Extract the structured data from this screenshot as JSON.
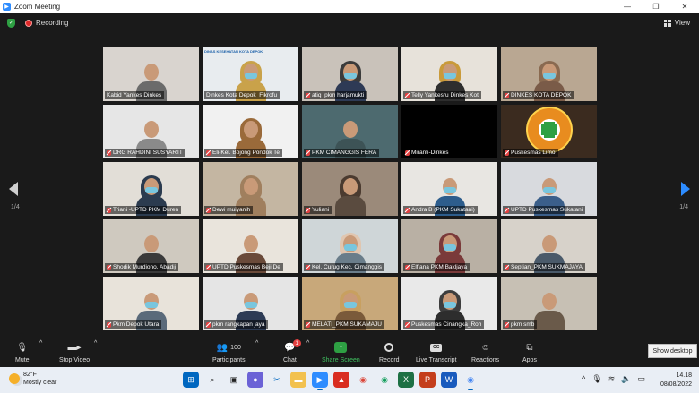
{
  "window": {
    "title": "Zoom Meeting",
    "app_icon": "zoom-icon"
  },
  "topbar": {
    "recording_label": "Recording",
    "view_label": "View"
  },
  "pagination": {
    "left": "1/4",
    "right": "1/4"
  },
  "colors": {
    "accent": "#2d8cff",
    "active_speaker": "#cfe23a",
    "recording": "#e02828",
    "share_green": "#2ea043"
  },
  "participants": [
    {
      "name": "Kabid Yankes Dinkes",
      "bg": "#d9d4cf",
      "shirt": "#6b6b6b",
      "hijab": "",
      "mask": false,
      "muted": false
    },
    {
      "name": "Dinkes Kota Depok_Fikrofu",
      "bg": "#e8ecef",
      "shirt": "#c9a24a",
      "hijab": "#c9a24a",
      "mask": true,
      "muted": false,
      "logo": "DINAS KESEHATAN KOTA DEPOK",
      "active": true
    },
    {
      "name": "atiq_pkm harjamukti",
      "bg": "#c9c2ba",
      "shirt": "#2e3a55",
      "hijab": "#3b3b3b",
      "mask": true,
      "muted": true
    },
    {
      "name": "Telly Yankesru Dinkes Kot",
      "bg": "#e7e2da",
      "shirt": "#2e2e2e",
      "hijab": "#c99a3a",
      "mask": true,
      "muted": true
    },
    {
      "name": "DINKES KOTA DEPOK",
      "bg": "#b9a792",
      "shirt": "#7a5b48",
      "hijab": "#8a6a50",
      "mask": true,
      "muted": true
    },
    {
      "name": "DRG RAHDINI SUSYARTI",
      "bg": "#e6e6e6",
      "shirt": "#8a8a8a",
      "hijab": "",
      "mask": false,
      "muted": true
    },
    {
      "name": "Eli-Kel. Bojong Pondok Te",
      "bg": "#f1f1f1",
      "shirt": "#9a6a3a",
      "hijab": "#9a6a3a",
      "mask": false,
      "muted": true
    },
    {
      "name": "PKM CIMANGGIS FERA",
      "bg": "#4d6a6f",
      "shirt": "#3d5356",
      "hijab": "",
      "mask": false,
      "muted": true
    },
    {
      "name": "Miranti-Dinkes",
      "bg": "#000000",
      "shirt": "#000000",
      "hijab": "",
      "mask": false,
      "muted": true,
      "black": true
    },
    {
      "name": "Puskesmas Limo",
      "bg": "#3b2b1f",
      "shirt": "#e88c1f",
      "hijab": "",
      "mask": false,
      "muted": true,
      "limo": true
    },
    {
      "name": "Triani -UPTD PKM Duren",
      "bg": "#e2ded7",
      "shirt": "#2b3b4f",
      "hijab": "#2b3b4f",
      "mask": true,
      "muted": true
    },
    {
      "name": "Dewi muiyanih",
      "bg": "#c4b6a2",
      "shirt": "#a07f5e",
      "hijab": "#a07f5e",
      "mask": false,
      "muted": true
    },
    {
      "name": "Yuliani",
      "bg": "#9b8a7a",
      "shirt": "#5a4b3f",
      "hijab": "#4b3b30",
      "mask": false,
      "muted": true
    },
    {
      "name": "Andra B (PKM Sukatani)",
      "bg": "#e8e6e2",
      "shirt": "#2d5d8c",
      "hijab": "",
      "mask": true,
      "muted": true
    },
    {
      "name": "UPTD Puskesmas Sukatani",
      "bg": "#d8dade",
      "shirt": "#3b5f8a",
      "hijab": "",
      "mask": true,
      "muted": true
    },
    {
      "name": "Shodik Murdiono, Abadij",
      "bg": "#cfc9bf",
      "shirt": "#3a3a3a",
      "hijab": "",
      "mask": false,
      "muted": true
    },
    {
      "name": "UPTD Puskesmas Beji De",
      "bg": "#e9e4dc",
      "shirt": "#6a4a3a",
      "hijab": "",
      "mask": false,
      "muted": true
    },
    {
      "name": "Kel. Curug Kec. Cimanggis",
      "bg": "#cfd6d8",
      "shirt": "#6a7d8a",
      "hijab": "#e0c6b0",
      "mask": true,
      "muted": true
    },
    {
      "name": "Elfiana PKM Bakljaya",
      "bg": "#b9b0a4",
      "shirt": "#7a3a3a",
      "hijab": "#7a3a3a",
      "mask": true,
      "muted": true
    },
    {
      "name": "Septian_PKM SUKMAJAYA",
      "bg": "#d7d2ca",
      "shirt": "#4a5a6a",
      "hijab": "",
      "mask": false,
      "muted": true
    },
    {
      "name": "Pkm Depok Utara",
      "bg": "#e8e3da",
      "shirt": "#5a6a7a",
      "hijab": "",
      "mask": true,
      "muted": true
    },
    {
      "name": "pkm rangkapan jaya",
      "bg": "#e5e5e5",
      "shirt": "#2d3b55",
      "hijab": "",
      "mask": true,
      "muted": true
    },
    {
      "name": "MELATI_PKM SUKAMAJU",
      "bg": "#c8a87a",
      "shirt": "#7a5a3a",
      "hijab": "#c8a060",
      "mask": true,
      "muted": true
    },
    {
      "name": "Puskesmas Cinangka_Roh",
      "bg": "#e9e9e9",
      "shirt": "#2d2d2d",
      "hijab": "#3d3d3d",
      "mask": true,
      "muted": true
    },
    {
      "name": "pkm smb",
      "bg": "#c7c0b4",
      "shirt": "#6a5a4a",
      "hijab": "",
      "mask": false,
      "muted": true
    }
  ],
  "controls": {
    "mute": "Mute",
    "stop_video": "Stop Video",
    "participants": "Participants",
    "participants_count": "100",
    "chat": "Chat",
    "chat_badge": "1",
    "share_screen": "Share Screen",
    "record": "Record",
    "live_transcript": "Live Transcript",
    "reactions": "Reactions",
    "apps": "Apps",
    "show_desktop": "Show desktop"
  },
  "taskbar": {
    "temperature": "82°F",
    "weather": "Mostly clear",
    "time": "14.18",
    "date": "08/08/2022",
    "apps": [
      {
        "name": "windows-start-icon",
        "bg": "#0067c0",
        "glyph": "⊞"
      },
      {
        "name": "search-icon",
        "bg": "#e9eef5",
        "glyph": "⌕",
        "fg": "#222"
      },
      {
        "name": "task-view-icon",
        "bg": "#e9eef5",
        "glyph": "▣",
        "fg": "#222"
      },
      {
        "name": "chat-app-icon",
        "bg": "#6b62d6",
        "glyph": "●"
      },
      {
        "name": "snip-icon",
        "bg": "#e9eef5",
        "glyph": "✂",
        "fg": "#0067c0"
      },
      {
        "name": "file-explorer-icon",
        "bg": "#f2c14e",
        "glyph": "▬"
      },
      {
        "name": "zoom-taskbar-icon",
        "bg": "#2d8cff",
        "glyph": "▶",
        "active": true
      },
      {
        "name": "pdf-icon",
        "bg": "#d92d20",
        "glyph": "▲"
      },
      {
        "name": "chrome-icon",
        "bg": "#e9eef5",
        "glyph": "◉",
        "fg": "#db4437"
      },
      {
        "name": "chrome-alt-icon",
        "bg": "#e9eef5",
        "glyph": "◉",
        "fg": "#0f9d58"
      },
      {
        "name": "excel-icon",
        "bg": "#1d7044",
        "glyph": "X"
      },
      {
        "name": "powerpoint-icon",
        "bg": "#c43e1c",
        "glyph": "P"
      },
      {
        "name": "word-icon",
        "bg": "#185abd",
        "glyph": "W"
      },
      {
        "name": "chrome-active-icon",
        "bg": "#e9eef5",
        "glyph": "◉",
        "fg": "#4285f4",
        "active": true
      }
    ]
  }
}
